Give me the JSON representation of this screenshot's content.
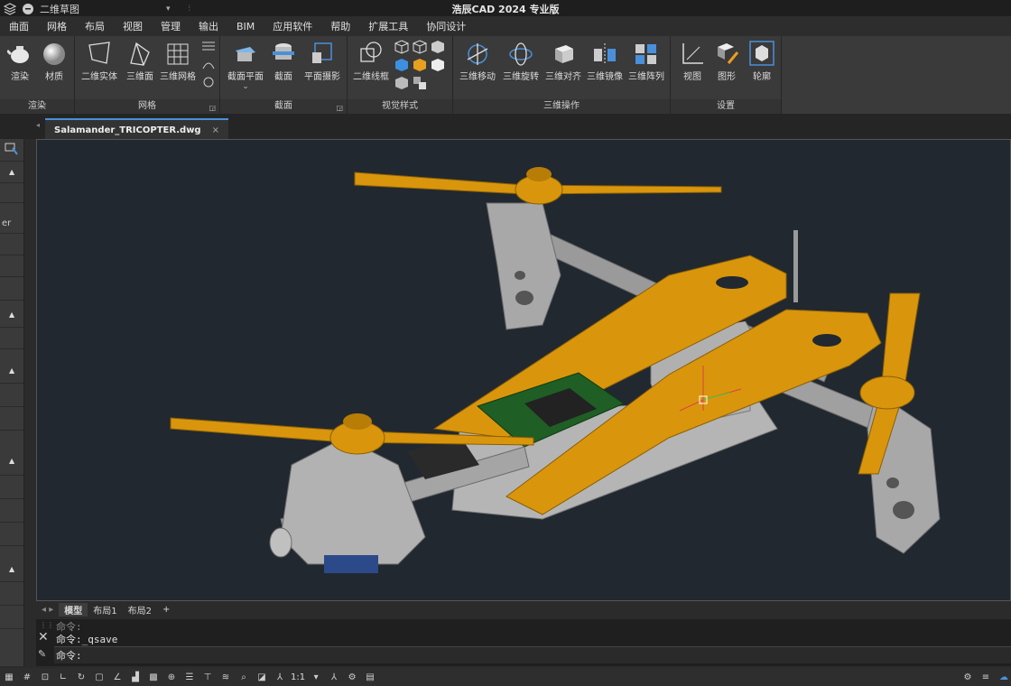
{
  "titlebar": {
    "workspace": "二维草图",
    "app_title": "浩辰CAD 2024 专业版"
  },
  "menu": [
    "曲面",
    "网格",
    "布局",
    "视图",
    "管理",
    "输出",
    "BIM",
    "应用软件",
    "帮助",
    "扩展工具",
    "协同设计"
  ],
  "ribbon": {
    "render": {
      "label": "渲染",
      "tools": [
        "渲染",
        "材质"
      ]
    },
    "mesh": {
      "label": "网格",
      "tools": [
        "二维实体",
        "三维面",
        "三维网格"
      ]
    },
    "section": {
      "label": "截面",
      "tools": [
        "截面平面",
        "截面",
        "平面摄影"
      ]
    },
    "visual": {
      "label": "视觉样式",
      "tools": [
        "二维线框"
      ]
    },
    "ops3d": {
      "label": "三维操作",
      "tools": [
        "三维移动",
        "三维旋转",
        "三维对齐",
        "三维镜像",
        "三维阵列"
      ]
    },
    "settings": {
      "label": "设置",
      "tools": [
        "视图",
        "图形",
        "轮廓"
      ]
    }
  },
  "doc_tab": {
    "name": "Salamander_TRICOPTER.dwg",
    "close": "×"
  },
  "left_panel": {
    "partial_text": "er"
  },
  "layout_tabs": [
    "模型",
    "布局1",
    "布局2",
    "+"
  ],
  "command": {
    "history": "命令:",
    "last": "命令:_qsave",
    "prompt": "命令:"
  },
  "status": {
    "scale": "1:1"
  },
  "colors": {
    "viewport_bg": "#212830",
    "frame": "#d9960c",
    "accent": "#4a90d9"
  }
}
